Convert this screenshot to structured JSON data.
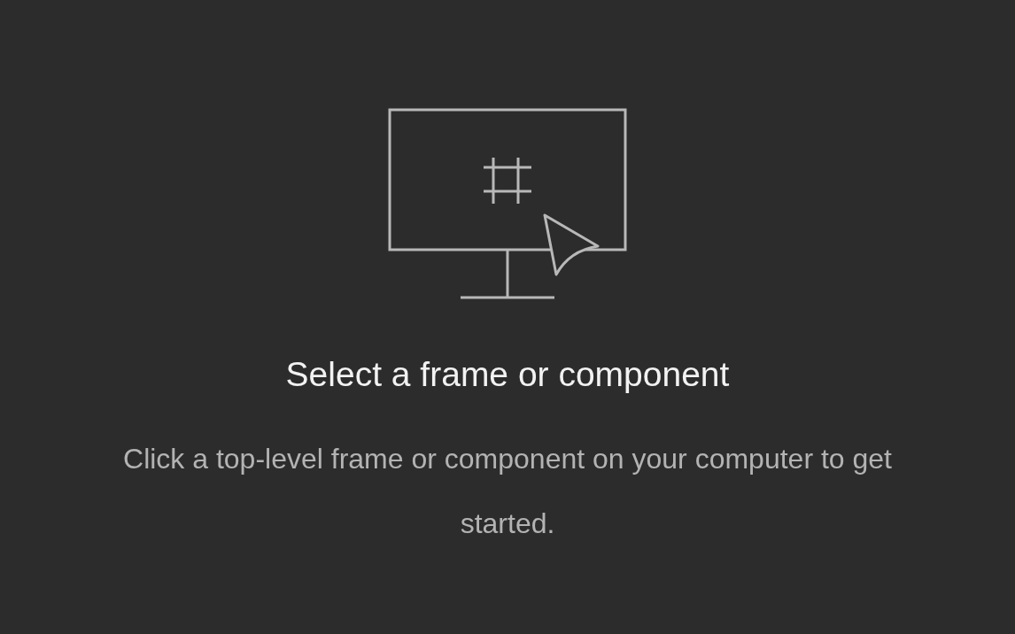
{
  "empty_state": {
    "title": "Select a frame or component",
    "description": "Click a top-level frame or component on your computer to get started."
  }
}
